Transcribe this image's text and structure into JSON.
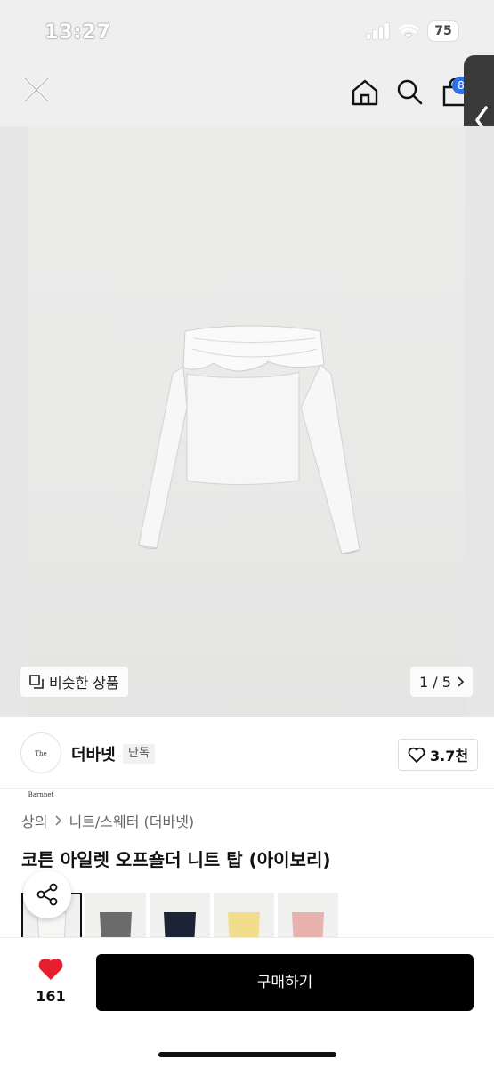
{
  "status_bar": {
    "time": "13:27",
    "battery": "75"
  },
  "top_nav": {
    "close_icon": "close-icon",
    "home_icon": "home-icon",
    "search_icon": "search-icon",
    "cart_icon": "shopping-bag-icon",
    "cart_badge": "8"
  },
  "gallery": {
    "similar_label": "비슷한 상품",
    "page": "1 / 5"
  },
  "brand": {
    "logo_text": "The Barnnet",
    "name": "더바넷",
    "tag": "단독",
    "likes": "3.7천"
  },
  "product": {
    "breadcrumb": [
      "상의",
      "니트/스웨터 (더바넷)"
    ],
    "title": "코튼 아일렛 오프숄더 니트 탑 (아이보리)"
  },
  "colors": {
    "swatches": [
      "#f6f6f4",
      "#6b6b6b",
      "#1d2336",
      "#f2dd8c",
      "#e7b1ad"
    ],
    "accent_like": "#e5202e",
    "buy_bg": "#000000",
    "badge_bg": "#2f6fe8"
  },
  "bottom_bar": {
    "wish_count": "161",
    "buy_label": "구매하기"
  }
}
